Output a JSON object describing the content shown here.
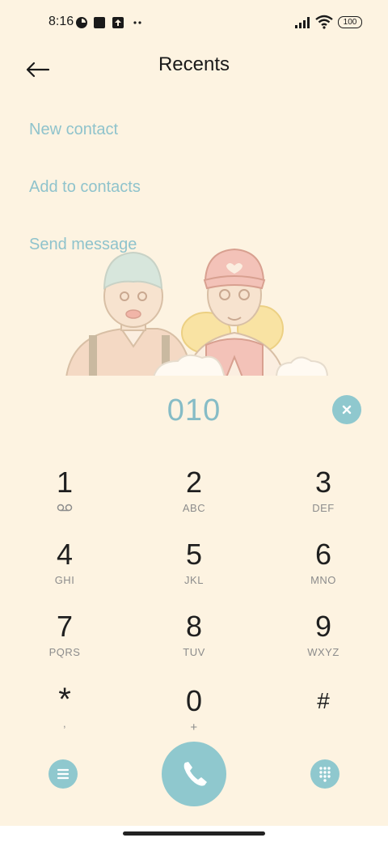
{
  "status_bar": {
    "time": "8:16",
    "battery": "100",
    "icons": [
      "data-saver-icon",
      "square-notification-icon",
      "upload-notification-icon",
      "more-notifications-icon",
      "signal-icon",
      "wifi-icon",
      "battery-icon"
    ]
  },
  "header": {
    "title": "Recents",
    "back_icon": "arrow-left-icon"
  },
  "actions": {
    "new_contact": "New contact",
    "add_to_contacts": "Add to contacts",
    "send_message": "Send message"
  },
  "dialer": {
    "number": "010",
    "clear_icon": "close-icon",
    "keys": [
      {
        "digit": "1",
        "letters": ""
      },
      {
        "digit": "2",
        "letters": "ABC"
      },
      {
        "digit": "3",
        "letters": "DEF"
      },
      {
        "digit": "4",
        "letters": "GHI"
      },
      {
        "digit": "5",
        "letters": "JKL"
      },
      {
        "digit": "6",
        "letters": "MNO"
      },
      {
        "digit": "7",
        "letters": "PQRS"
      },
      {
        "digit": "8",
        "letters": "TUV"
      },
      {
        "digit": "9",
        "letters": "WXYZ"
      },
      {
        "digit": "*",
        "letters": ","
      },
      {
        "digit": "0",
        "letters": "+"
      },
      {
        "digit": "#",
        "letters": ""
      }
    ]
  },
  "bottom_bar": {
    "menu_icon": "menu-icon",
    "call_icon": "phone-icon",
    "keypad_icon": "dialpad-icon"
  },
  "colors": {
    "background": "#fdf3e1",
    "accent": "#8fc8ce",
    "link": "#8fc3cc"
  }
}
